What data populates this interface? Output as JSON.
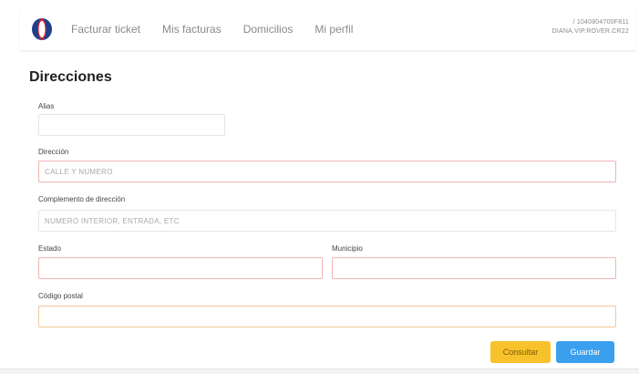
{
  "colors": {
    "logo_blue": "#1f3f8c",
    "logo_red": "#e0262b",
    "consultar_button": "#f7c22b",
    "guardar_button": "#3aa0ee",
    "field_border_error": "#f2b3b3",
    "field_border_neutral": "#e6e6e6"
  },
  "nav": {
    "logo_icon": "brand-logo-icon",
    "links": [
      "Facturar ticket",
      "Mis facturas",
      "Domicilios",
      "Mi perfil"
    ]
  },
  "user": {
    "id_line": "/ 1040804700F811",
    "email_line": "DIANA.VIP.ROVER.CR22"
  },
  "form": {
    "title": "Direcciones",
    "alias": {
      "label": "Alias",
      "value": "",
      "placeholder": ""
    },
    "direccion": {
      "label": "Dirección",
      "value": "",
      "placeholder": "CALLE Y NUMERO"
    },
    "complemento": {
      "label": "Complemento de dirección",
      "value": "",
      "placeholder": "NUMERO INTERIOR, ENTRADA, ETC"
    },
    "estado": {
      "label": "Estado",
      "value": "",
      "placeholder": ""
    },
    "municipio": {
      "label": "Municipio",
      "value": "",
      "placeholder": ""
    },
    "codigo_postal": {
      "label": "Código postal",
      "value": "",
      "placeholder": ""
    }
  },
  "actions": {
    "consultar_label": "Consultar",
    "guardar_label": "Guardar"
  }
}
